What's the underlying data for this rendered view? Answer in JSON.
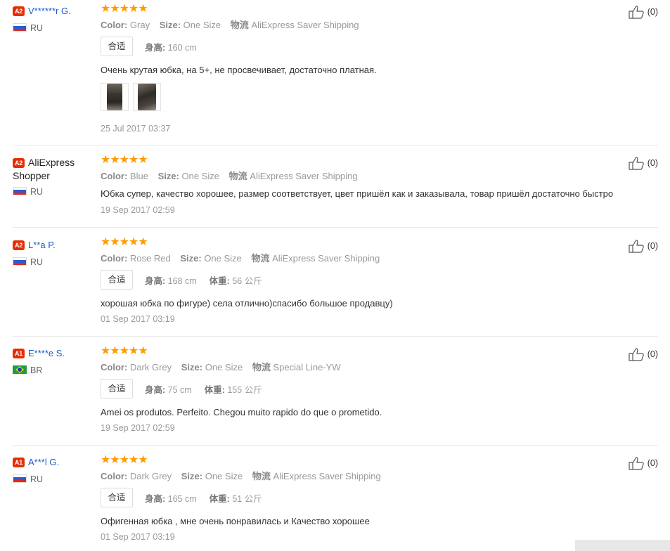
{
  "labels": {
    "color": "Color:",
    "size": "Size:",
    "logistics": "物流",
    "fit_box": "合适",
    "height": "身高:",
    "weight": "体重:"
  },
  "reviews": [
    {
      "level": "A2",
      "name": "V******r G.",
      "country": "RU",
      "flag": "ru",
      "stars": "★★★★★",
      "color": "Gray",
      "size": "One Size",
      "shipping": "AliExpress Saver Shipping",
      "height": "160 cm",
      "text": "Очень крутая юбка, на 5+, не просвечивает, достаточно платная.",
      "date": "25 Jul 2017 03:37",
      "useful": "(0)"
    },
    {
      "level": "A2",
      "name": "AliExpress",
      "name2": "Shopper",
      "country": "RU",
      "flag": "ru",
      "stars": "★★★★★",
      "color": "Blue",
      "size": "One Size",
      "shipping": "AliExpress Saver Shipping",
      "text": "Юбка супер, качество хорошее, размер соответствует, цвет пришёл как и заказывала, товар пришёл достаточно быстро",
      "date": "19 Sep 2017 02:59",
      "useful": "(0)"
    },
    {
      "level": "A2",
      "name": "L**a P.",
      "country": "RU",
      "flag": "ru",
      "stars": "★★★★★",
      "color": "Rose Red",
      "size": "One Size",
      "shipping": "AliExpress Saver Shipping",
      "height": "168 cm",
      "weight": "56 公斤",
      "text": "хорошая юбка по фигуре) села отлично)спасибо большое продавцу)",
      "date": "01 Sep 2017 03:19",
      "useful": "(0)"
    },
    {
      "level": "A1",
      "name": "E****e S.",
      "country": "BR",
      "flag": "br",
      "stars": "★★★★★",
      "color": "Dark Grey",
      "size": "One Size",
      "shipping": "Special Line-YW",
      "height": "75 cm",
      "weight": "155 公斤",
      "text": "Amei os produtos. Perfeito. Chegou muito rapido do que o prometido.",
      "date": "19 Sep 2017 02:59",
      "useful": "(0)"
    },
    {
      "level": "A1",
      "name": "A***l G.",
      "country": "RU",
      "flag": "ru",
      "stars": "★★★★★",
      "color": "Dark Grey",
      "size": "One Size",
      "shipping": "AliExpress Saver Shipping",
      "height": "165 cm",
      "weight": "51 公斤",
      "text": "Офигенная юбка , мне очень понравилась и Качество хорошее",
      "date": "01 Sep 2017 03:19",
      "useful": "(0)"
    }
  ]
}
